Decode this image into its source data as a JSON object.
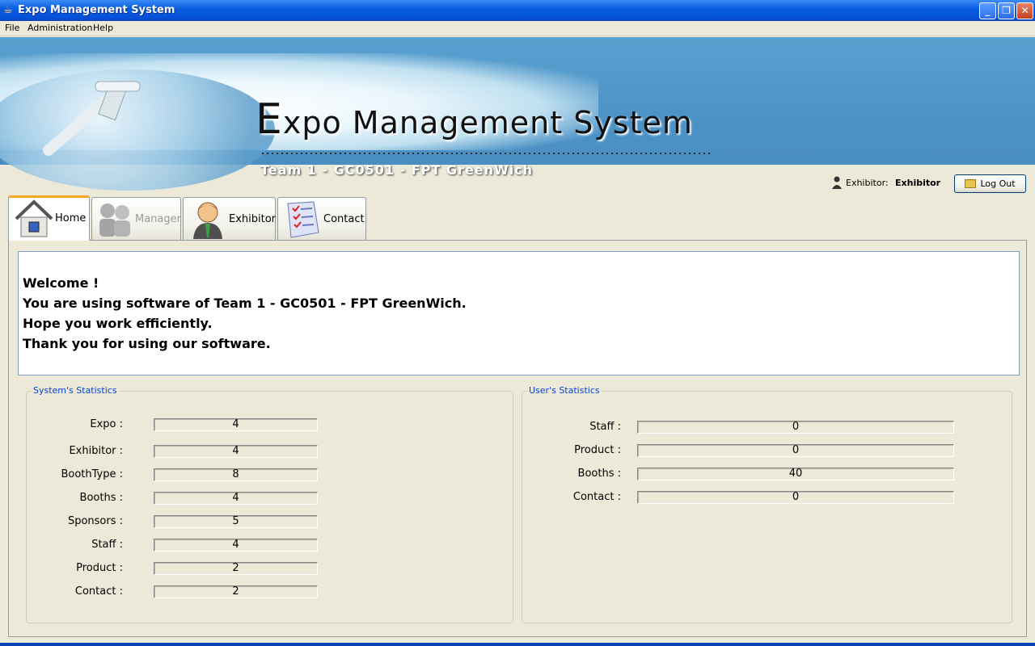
{
  "window": {
    "title": "Expo Management System",
    "minimize": "_",
    "restore": "❐",
    "close": "✕"
  },
  "menu": [
    "File",
    "Administration",
    "Help"
  ],
  "banner": {
    "title_cap": "E",
    "title_rest": "xpo Management System",
    "subtitle": "Team 1 - GC0501 - FPT GreenWich"
  },
  "user": {
    "role_label": "Exhibitor:",
    "name": "Exhibitor",
    "logout_label": "Log Out"
  },
  "tabs": [
    {
      "label": "Home",
      "active": true,
      "icon": "home-icon"
    },
    {
      "label": "Manager",
      "disabled": true,
      "icon": "manager-icon"
    },
    {
      "label": "Exhibitor",
      "icon": "exhibitor-icon"
    },
    {
      "label": "Contact",
      "icon": "contact-checklist-icon"
    }
  ],
  "welcome": [
    "Welcome !",
    "You are using software of Team 1 - GC0501 - FPT GreenWich.",
    "Hope you work efficiently.",
    "Thank you for using our software."
  ],
  "system_stats": {
    "title": "System's Statistics",
    "rows": [
      {
        "label": "Expo :",
        "value": "4"
      },
      {
        "label": "Exhibitor :",
        "value": "4"
      },
      {
        "label": "BoothType :",
        "value": "8"
      },
      {
        "label": "Booths :",
        "value": "4"
      },
      {
        "label": "Sponsors :",
        "value": "5"
      },
      {
        "label": "Staff :",
        "value": "4"
      },
      {
        "label": "Product :",
        "value": "2"
      },
      {
        "label": "Contact :",
        "value": "2"
      }
    ]
  },
  "user_stats": {
    "title": "User's Statistics",
    "rows": [
      {
        "label": "Staff :",
        "value": "0"
      },
      {
        "label": "Product :",
        "value": "0"
      },
      {
        "label": "Booths :",
        "value": "40"
      },
      {
        "label": "Contact :",
        "value": "0"
      }
    ]
  }
}
